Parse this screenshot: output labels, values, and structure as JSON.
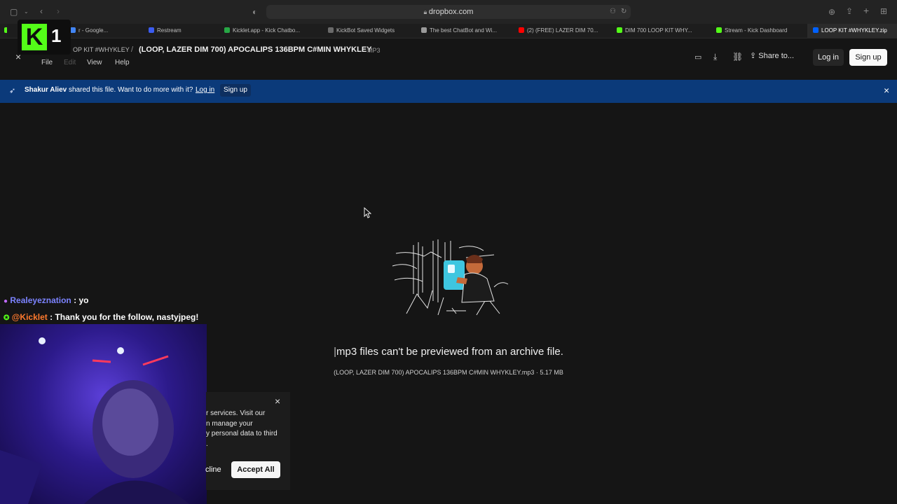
{
  "browser": {
    "url": "dropbox.com",
    "tabs": [
      {
        "label": "r - Google...",
        "color": "#4285f4"
      },
      {
        "label": "Restream",
        "color": "#3b5cf0"
      },
      {
        "label": "Kicklet.app - Kick Chatbo...",
        "color": "#27a745"
      },
      {
        "label": "KickBot Saved Widgets",
        "color": "#6a6a6a"
      },
      {
        "label": "The best ChatBot and Wi...",
        "color": "#9a9a9a"
      },
      {
        "label": "(2) (FREE) LAZER DIM 70...",
        "color": "#ff0000"
      },
      {
        "label": "DIM 700 LOOP KIT WHY...",
        "color": "#53fc18"
      },
      {
        "label": "Stream - Kick Dashboard",
        "color": "#53fc18"
      },
      {
        "label": "LOOP KIT #WHYKLEY.zip",
        "color": "#0061fe"
      }
    ]
  },
  "kick_badge": {
    "letter": "K",
    "count": "1"
  },
  "file_header": {
    "breadcrumb_parent": "OP KIT #WHYKLEY",
    "separator": "/",
    "title": "(LOOP, LAZER DIM 700) APOCALIPS 136BPM C#MIN WHYKLEY",
    "ext": "MP3",
    "menu": [
      "File",
      "Edit",
      "View",
      "Help"
    ],
    "share_label": "Share to...",
    "login": "Log in",
    "signup": "Sign up"
  },
  "banner": {
    "sharer": "Shakur Aliev",
    "message": " shared this file. Want to do more with it?",
    "login": "Log in",
    "signup": "Sign up"
  },
  "preview": {
    "cursor_mark": "|",
    "message": "mp3 files can't be previewed from an archive file.",
    "file_info": "(LOOP, LAZER DIM 700) APOCALIPS 136BPM C#MIN WHYKLEY.mp3 · 5.17 MB"
  },
  "chat": [
    {
      "user": "Realeyeznation",
      "sep": " : ",
      "text": "yo",
      "color": "#7c83ff"
    },
    {
      "user": "@Kicklet",
      "sep": " : ",
      "text": "Thank you for the follow, nastyjpeg!",
      "color": "#ff7a2e"
    }
  ],
  "cookie": {
    "lines": [
      "r services. Visit our",
      "n manage your",
      "y personal data to third",
      "."
    ],
    "decline": "cline",
    "accept": "Accept All"
  }
}
